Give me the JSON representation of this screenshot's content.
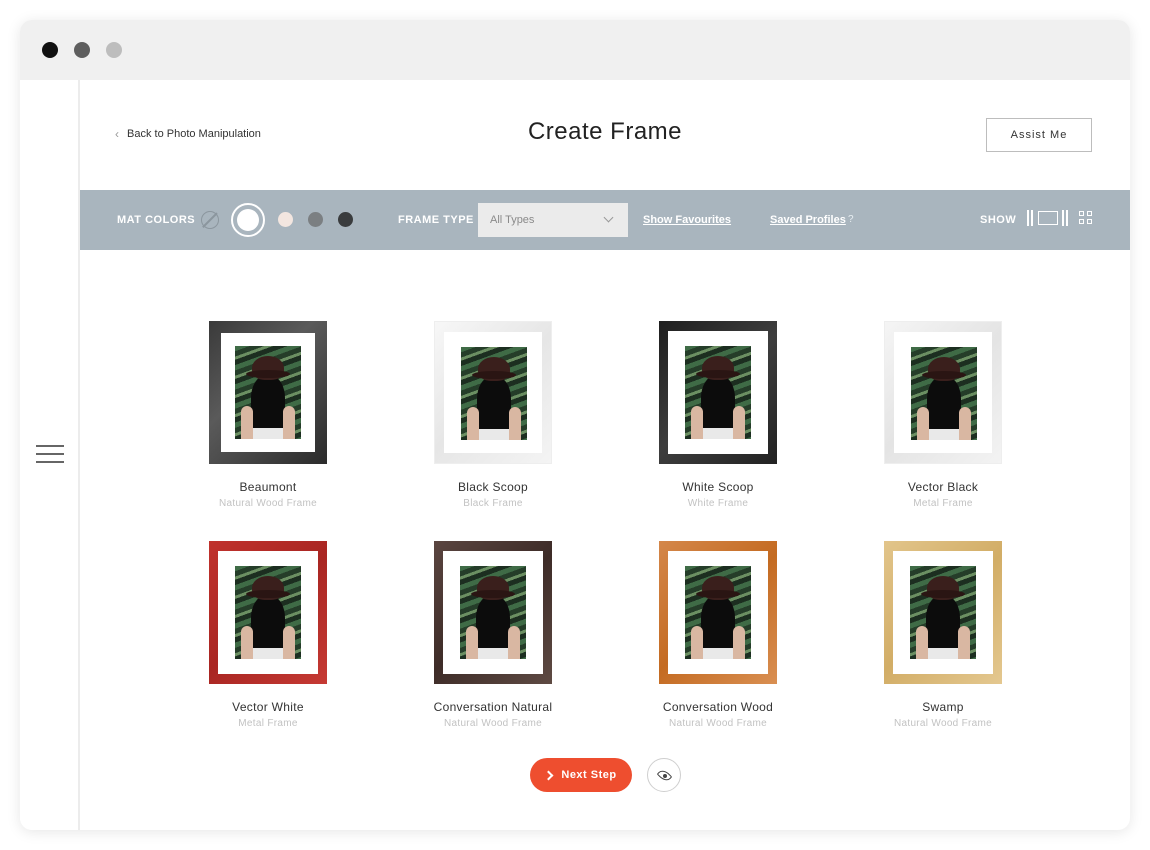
{
  "header": {
    "back_label": "Back to Photo Manipulation",
    "title": "Create Frame",
    "assist_label": "Assist Me"
  },
  "toolbar": {
    "mat_colors_label": "MAT COLORS",
    "mat_colors": [
      "none",
      "#ffffff",
      "#f3e6e0",
      "#7b7f82",
      "#3a3c3e"
    ],
    "selected_mat_color": "#ffffff",
    "frame_type_label": "FRAME TYPE",
    "frame_type_value": "All Types",
    "show_favourites": "Show Favourites",
    "saved_profiles": "Saved Profiles",
    "help_mark": "?",
    "show_label": "SHOW"
  },
  "frames": [
    {
      "name": "Beaumont",
      "type": "Natural Wood Frame",
      "color": "#3a3a3a"
    },
    {
      "name": "Black Scoop",
      "type": "Black Frame",
      "color": "#f0f0f0"
    },
    {
      "name": "White Scoop",
      "type": "White Frame",
      "color": "#2a2a2a"
    },
    {
      "name": "Vector Black",
      "type": "Metal Frame",
      "color": "#eeeeee"
    },
    {
      "name": "Vector White",
      "type": "Metal Frame",
      "color": "#b52c27"
    },
    {
      "name": "Conversation Natural",
      "type": "Natural Wood Frame",
      "color": "#4a3631"
    },
    {
      "name": "Conversation Wood",
      "type": "Natural Wood Frame",
      "color": "#cc7a35"
    },
    {
      "name": "Swamp",
      "type": "Natural Wood Frame",
      "color": "#d9b878"
    }
  ],
  "footer": {
    "next_label": "Next Step"
  },
  "colors": {
    "toolbar_bg": "#a9b5be",
    "accent": "#ee4e2f"
  }
}
